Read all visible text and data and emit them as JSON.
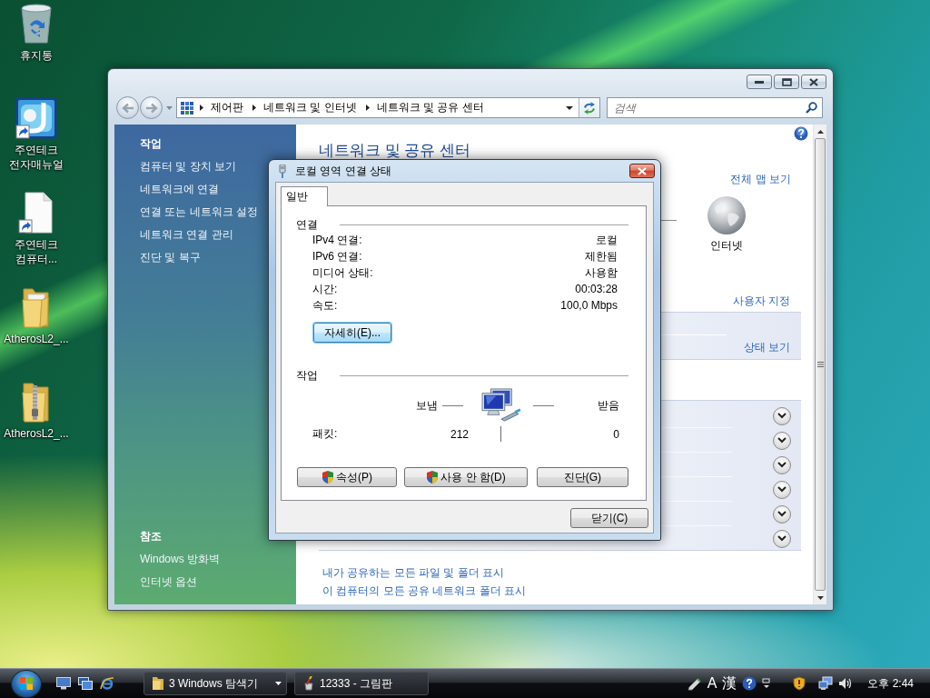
{
  "desktop_icons": [
    {
      "label": "휴지통",
      "kind": "recycle-bin"
    },
    {
      "label": "주연테크 전자매뉴얼",
      "kind": "app-shortcut"
    },
    {
      "label": "주연테크 컴퓨터...",
      "kind": "document-shortcut"
    },
    {
      "label": "AtherosL2_...",
      "kind": "folder"
    },
    {
      "label": "AtherosL2_...",
      "kind": "zip-folder"
    }
  ],
  "explorer": {
    "address_path": [
      "제어판",
      "네트워크 및 인터넷",
      "네트워크 및 공유 센터"
    ],
    "search": {
      "placeholder": "검색"
    },
    "sidebar": {
      "sections": [
        {
          "heading": "작업",
          "items": [
            "컴퓨터 및 장치 보기",
            "네트워크에 연결",
            "연결 또는 네트워크 설정",
            "네트워크 연결 관리",
            "진단 및 복구"
          ]
        },
        {
          "heading": "참조",
          "items": [
            "Windows 방화벽",
            "인터넷 옵션"
          ]
        }
      ]
    },
    "content": {
      "title": "네트워크 및 공유 센터",
      "map_link": "전체 맵 보기",
      "internet_label": "인터넷",
      "customize_link": "사용자 지정",
      "status_link": "상태 보기",
      "sharing_settings": [
        {
          "expanded": false
        },
        {
          "expanded": false
        },
        {
          "expanded": false
        },
        {
          "expanded": false
        },
        {
          "expanded": false
        },
        {
          "expanded": false
        }
      ],
      "links": [
        "내가 공유하는 모든 파일 및 폴더 표시",
        "이 컴퓨터의 모든 공유 네트워크 폴더 표시"
      ]
    }
  },
  "dialog": {
    "title": "로컬 영역 연결 상태",
    "tabs": [
      {
        "label": "일반",
        "selected": true
      }
    ],
    "connection": {
      "heading": "연결",
      "rows": [
        {
          "label": "IPv4 연결:",
          "value": "로컬"
        },
        {
          "label": "IPv6 연결:",
          "value": "제한됨"
        },
        {
          "label": "미디어 상태:",
          "value": "사용함"
        },
        {
          "label": "시간:",
          "value": "00:03:28"
        },
        {
          "label": "속도:",
          "value": "100,0 Mbps"
        }
      ]
    },
    "details_button": {
      "label": "자세히(E)...",
      "focused": true
    },
    "activity": {
      "heading": "작업",
      "sent_label": "보냄",
      "received_label": "받음",
      "packets_label": "패킷:",
      "sent": "212",
      "received": "0"
    },
    "buttons": [
      {
        "label": "속성(P)",
        "shield": true
      },
      {
        "label": "사용 안 함(D)",
        "shield": true
      },
      {
        "label": "진단(G)",
        "shield": false
      }
    ],
    "close_button": "닫기(C)"
  },
  "taskbar": {
    "tasks": [
      {
        "label": "3 Windows 탐색기",
        "kind": "group"
      },
      {
        "label": "12333 - 그림판",
        "kind": "window"
      }
    ],
    "ime_indicators": [
      "A",
      "漢"
    ],
    "clock": "오후 2:44"
  }
}
